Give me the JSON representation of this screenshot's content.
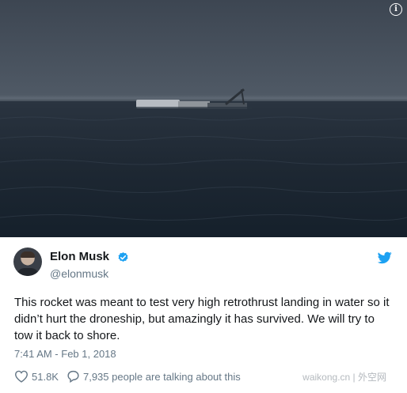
{
  "tweet": {
    "author_name": "Elon Musk",
    "author_handle": "@elonmusk",
    "text": "This rocket was meant to test very high retrothrust landing in water so it didn’t hurt the droneship, but amazingly it has survived. We will try to tow it back to shore.",
    "timestamp": "7:41 AM - Feb 1, 2018",
    "likes": "51.8K",
    "conversation": "7,935 people are talking about this"
  },
  "watermark": "waikong.cn | 外空网",
  "colors": {
    "text": "#14171a",
    "secondary": "#657786",
    "twitter_blue": "#1da1f2"
  },
  "icons": {
    "info": "info-icon",
    "verified": "verified-badge-icon",
    "twitter": "twitter-bird-icon",
    "like": "heart-icon",
    "reply": "speech-bubble-icon"
  }
}
